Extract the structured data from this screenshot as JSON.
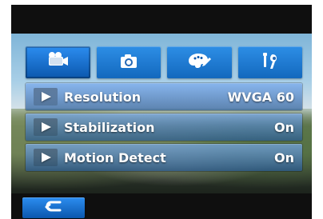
{
  "tabs": [
    {
      "name": "video-tab",
      "icon": "video-camera-icon"
    },
    {
      "name": "photo-tab",
      "icon": "camera-icon"
    },
    {
      "name": "effects-tab",
      "icon": "palette-brush-icon"
    },
    {
      "name": "setup-tab",
      "icon": "tools-icon"
    }
  ],
  "menu": {
    "items": [
      {
        "label": "Resolution",
        "value": "WVGA 60"
      },
      {
        "label": "Stabilization",
        "value": "On"
      },
      {
        "label": "Motion Detect",
        "value": "On"
      }
    ]
  },
  "bottom": {
    "back_icon": "return-arrow-icon"
  },
  "colors": {
    "accent": "#1a73d1",
    "accent_dark": "#0b57ad",
    "text": "#ffffff",
    "frame": "#0f0f0f"
  }
}
